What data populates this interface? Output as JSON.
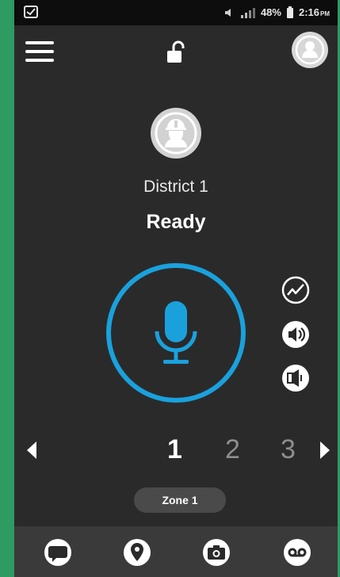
{
  "status_bar": {
    "battery": "48%",
    "time": "2:16",
    "time_suffix": "PM"
  },
  "channel": {
    "name": "District 1",
    "status": "Ready"
  },
  "pager": {
    "pages": [
      "1",
      "2",
      "3"
    ],
    "active_page": "1"
  },
  "zone": {
    "label": "Zone 1"
  },
  "colors": {
    "accent": "#1aa1dc",
    "background": "#2a2a2b",
    "frame": "#2f9a62"
  },
  "icons": {
    "app_bar": [
      "menu-icon",
      "unlock-icon",
      "profile-icon"
    ],
    "side": [
      "activity-icon",
      "speaker-icon",
      "speaker-muted-icon"
    ],
    "bottom_nav": [
      "message-icon",
      "location-icon",
      "camera-icon",
      "voicemail-icon"
    ]
  }
}
